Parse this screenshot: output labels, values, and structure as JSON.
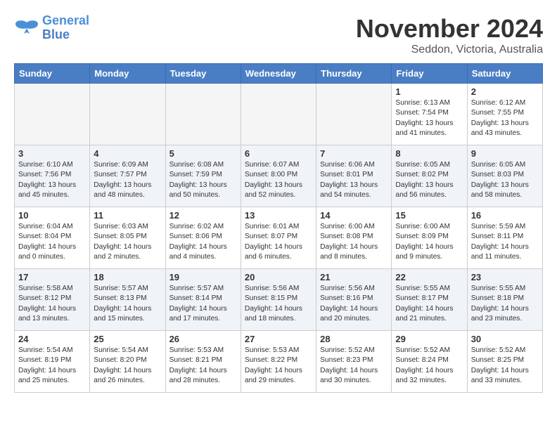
{
  "header": {
    "logo_line1": "General",
    "logo_line2": "Blue",
    "month": "November 2024",
    "location": "Seddon, Victoria, Australia"
  },
  "days_of_week": [
    "Sunday",
    "Monday",
    "Tuesday",
    "Wednesday",
    "Thursday",
    "Friday",
    "Saturday"
  ],
  "weeks": [
    [
      {
        "day": "",
        "info": ""
      },
      {
        "day": "",
        "info": ""
      },
      {
        "day": "",
        "info": ""
      },
      {
        "day": "",
        "info": ""
      },
      {
        "day": "",
        "info": ""
      },
      {
        "day": "1",
        "info": "Sunrise: 6:13 AM\nSunset: 7:54 PM\nDaylight: 13 hours\nand 41 minutes."
      },
      {
        "day": "2",
        "info": "Sunrise: 6:12 AM\nSunset: 7:55 PM\nDaylight: 13 hours\nand 43 minutes."
      }
    ],
    [
      {
        "day": "3",
        "info": "Sunrise: 6:10 AM\nSunset: 7:56 PM\nDaylight: 13 hours\nand 45 minutes."
      },
      {
        "day": "4",
        "info": "Sunrise: 6:09 AM\nSunset: 7:57 PM\nDaylight: 13 hours\nand 48 minutes."
      },
      {
        "day": "5",
        "info": "Sunrise: 6:08 AM\nSunset: 7:59 PM\nDaylight: 13 hours\nand 50 minutes."
      },
      {
        "day": "6",
        "info": "Sunrise: 6:07 AM\nSunset: 8:00 PM\nDaylight: 13 hours\nand 52 minutes."
      },
      {
        "day": "7",
        "info": "Sunrise: 6:06 AM\nSunset: 8:01 PM\nDaylight: 13 hours\nand 54 minutes."
      },
      {
        "day": "8",
        "info": "Sunrise: 6:05 AM\nSunset: 8:02 PM\nDaylight: 13 hours\nand 56 minutes."
      },
      {
        "day": "9",
        "info": "Sunrise: 6:05 AM\nSunset: 8:03 PM\nDaylight: 13 hours\nand 58 minutes."
      }
    ],
    [
      {
        "day": "10",
        "info": "Sunrise: 6:04 AM\nSunset: 8:04 PM\nDaylight: 14 hours\nand 0 minutes."
      },
      {
        "day": "11",
        "info": "Sunrise: 6:03 AM\nSunset: 8:05 PM\nDaylight: 14 hours\nand 2 minutes."
      },
      {
        "day": "12",
        "info": "Sunrise: 6:02 AM\nSunset: 8:06 PM\nDaylight: 14 hours\nand 4 minutes."
      },
      {
        "day": "13",
        "info": "Sunrise: 6:01 AM\nSunset: 8:07 PM\nDaylight: 14 hours\nand 6 minutes."
      },
      {
        "day": "14",
        "info": "Sunrise: 6:00 AM\nSunset: 8:08 PM\nDaylight: 14 hours\nand 8 minutes."
      },
      {
        "day": "15",
        "info": "Sunrise: 6:00 AM\nSunset: 8:09 PM\nDaylight: 14 hours\nand 9 minutes."
      },
      {
        "day": "16",
        "info": "Sunrise: 5:59 AM\nSunset: 8:11 PM\nDaylight: 14 hours\nand 11 minutes."
      }
    ],
    [
      {
        "day": "17",
        "info": "Sunrise: 5:58 AM\nSunset: 8:12 PM\nDaylight: 14 hours\nand 13 minutes."
      },
      {
        "day": "18",
        "info": "Sunrise: 5:57 AM\nSunset: 8:13 PM\nDaylight: 14 hours\nand 15 minutes."
      },
      {
        "day": "19",
        "info": "Sunrise: 5:57 AM\nSunset: 8:14 PM\nDaylight: 14 hours\nand 17 minutes."
      },
      {
        "day": "20",
        "info": "Sunrise: 5:56 AM\nSunset: 8:15 PM\nDaylight: 14 hours\nand 18 minutes."
      },
      {
        "day": "21",
        "info": "Sunrise: 5:56 AM\nSunset: 8:16 PM\nDaylight: 14 hours\nand 20 minutes."
      },
      {
        "day": "22",
        "info": "Sunrise: 5:55 AM\nSunset: 8:17 PM\nDaylight: 14 hours\nand 21 minutes."
      },
      {
        "day": "23",
        "info": "Sunrise: 5:55 AM\nSunset: 8:18 PM\nDaylight: 14 hours\nand 23 minutes."
      }
    ],
    [
      {
        "day": "24",
        "info": "Sunrise: 5:54 AM\nSunset: 8:19 PM\nDaylight: 14 hours\nand 25 minutes."
      },
      {
        "day": "25",
        "info": "Sunrise: 5:54 AM\nSunset: 8:20 PM\nDaylight: 14 hours\nand 26 minutes."
      },
      {
        "day": "26",
        "info": "Sunrise: 5:53 AM\nSunset: 8:21 PM\nDaylight: 14 hours\nand 28 minutes."
      },
      {
        "day": "27",
        "info": "Sunrise: 5:53 AM\nSunset: 8:22 PM\nDaylight: 14 hours\nand 29 minutes."
      },
      {
        "day": "28",
        "info": "Sunrise: 5:52 AM\nSunset: 8:23 PM\nDaylight: 14 hours\nand 30 minutes."
      },
      {
        "day": "29",
        "info": "Sunrise: 5:52 AM\nSunset: 8:24 PM\nDaylight: 14 hours\nand 32 minutes."
      },
      {
        "day": "30",
        "info": "Sunrise: 5:52 AM\nSunset: 8:25 PM\nDaylight: 14 hours\nand 33 minutes."
      }
    ]
  ]
}
